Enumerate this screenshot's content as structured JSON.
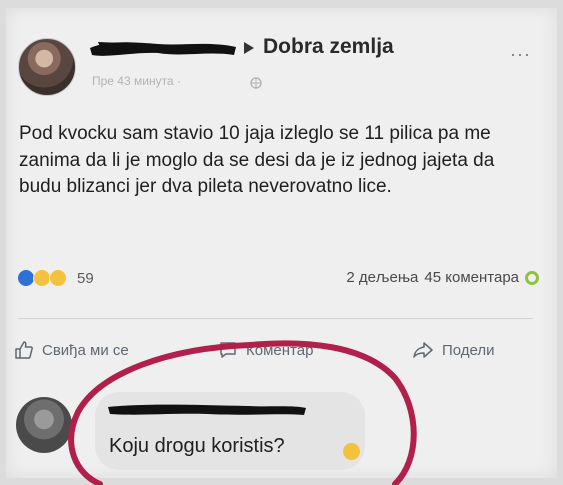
{
  "post": {
    "group_name": "Dobra zemlja",
    "time": "Пре 43 минута · ",
    "body": "Pod kvocku sam stavio 10 jaja izleglo se 11 pilica pa me zanima da li je moglo da se desi da je iz jednog jajeta da budu blizanci jer dva pileta neverovatno lice.",
    "reaction_count": "59",
    "shares": "2 дељења",
    "comments": "45 коментара",
    "more_label": "···"
  },
  "actions": {
    "like": "Свиђа ми се",
    "comment": "Коментар",
    "share": "Подели"
  },
  "comment": {
    "text": "Koju drogu koristis?"
  },
  "colors": {
    "annotation_circle": "#b0204a",
    "like_blue": "#2f6fd8",
    "redaction": "#111111"
  },
  "icons": [
    "arrow-right-icon",
    "globe-icon",
    "more-icon",
    "like-reaction-icon",
    "haha-reaction-icon",
    "wow-reaction-icon",
    "like-icon",
    "comment-icon",
    "share-icon",
    "laughing-emoji-icon"
  ]
}
